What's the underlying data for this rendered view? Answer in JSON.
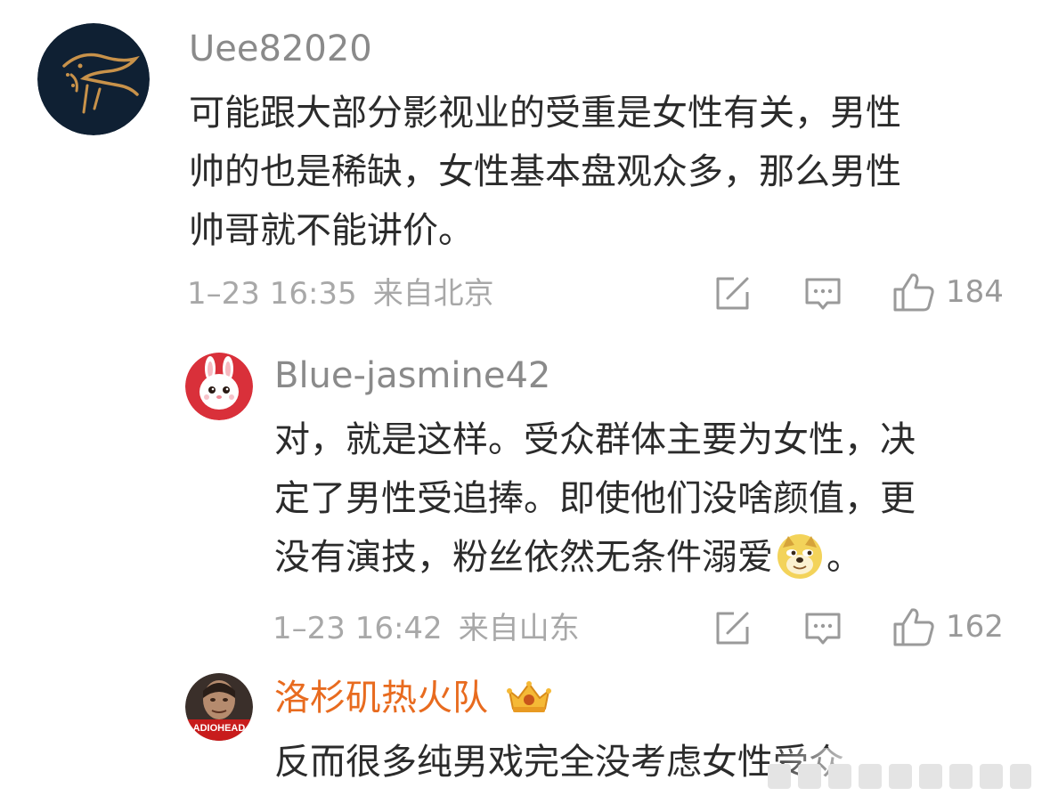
{
  "comments": [
    {
      "username": "Uee82020",
      "text_lines": [
        "可能跟大部分影视业的受重是女性有关，男性",
        "帅的也是稀缺，女性基本盘观众多，那么男性",
        "帅哥就不能讲价。"
      ],
      "time": "1–23 16:35",
      "location": "来自北京",
      "likes": "184",
      "avatar_icon": "dragon-logo-avatar"
    },
    {
      "username": "Blue-jasmine42",
      "text_lines": [
        "对，就是这样。受众群体主要为女性，决",
        "定了男性受追捧。即使他们没啥颜值，更"
      ],
      "text_line3_before": "没有演技，粉丝依然无条件溺爱",
      "text_line3_after": "。",
      "emoji_icon": "doge-emoji",
      "time": "1–23 16:42",
      "location": "来自山东",
      "likes": "162",
      "avatar_icon": "bunny-avatar"
    },
    {
      "username": "洛杉矶热火队",
      "badge_icon": "vip-crown-icon",
      "text_lines": [
        "反而很多纯男戏完全没考虑女性受众"
      ],
      "avatar_icon": "radiohead-avatar",
      "avatar_text": "ADIOHEAD"
    }
  ],
  "actions": {
    "share_icon": "share-edit-icon",
    "reply_icon": "comment-icon",
    "like_icon": "thumbs-up-icon"
  },
  "colors": {
    "username": "#8a8a8a",
    "vip_username": "#e86b1f",
    "text": "#2b2b2b",
    "meta": "#a8a8a8"
  }
}
